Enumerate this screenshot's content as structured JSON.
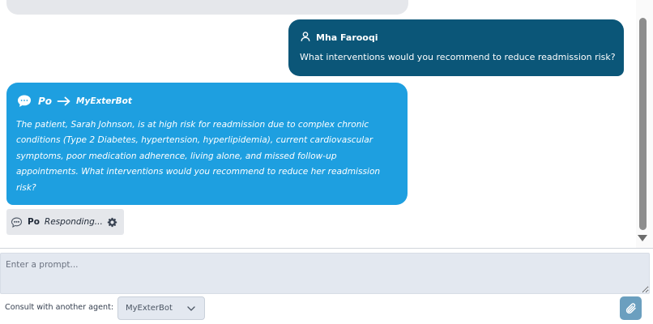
{
  "colors": {
    "user_bubble": "#0b5678",
    "bot_bubble": "#1e9fe0",
    "pill_bg": "#e5e7eb",
    "input_bg": "#e3e8f0",
    "attach_button": "#6b9fbf"
  },
  "messages": {
    "user": {
      "icon": "user-icon",
      "name": "Mha Farooqi",
      "text": "What interventions would you recommend to reduce readmission risk?"
    },
    "bot": {
      "icon": "chat-bubble-icon",
      "from": "Po",
      "arrow_icon": "arrow-right-icon",
      "to": "MyExterBot",
      "text": "The patient, Sarah Johnson, is at high risk for readmission due to complex chronic conditions (Type 2 Diabetes, hypertension, hyperlipidemia), current cardiovascular symptoms, poor medication adherence, living alone, and missed follow-up appointments. What interventions would you recommend to reduce her readmission risk?"
    },
    "status": {
      "icon": "chat-bubble-icon",
      "name": "Po",
      "text": "Responding...",
      "spinner_icon": "gear-icon"
    }
  },
  "composer": {
    "placeholder": "Enter a prompt...",
    "consult_label": "Consult with another agent:",
    "agent_selected": "MyExterBot",
    "attach_icon": "paperclip-icon"
  }
}
